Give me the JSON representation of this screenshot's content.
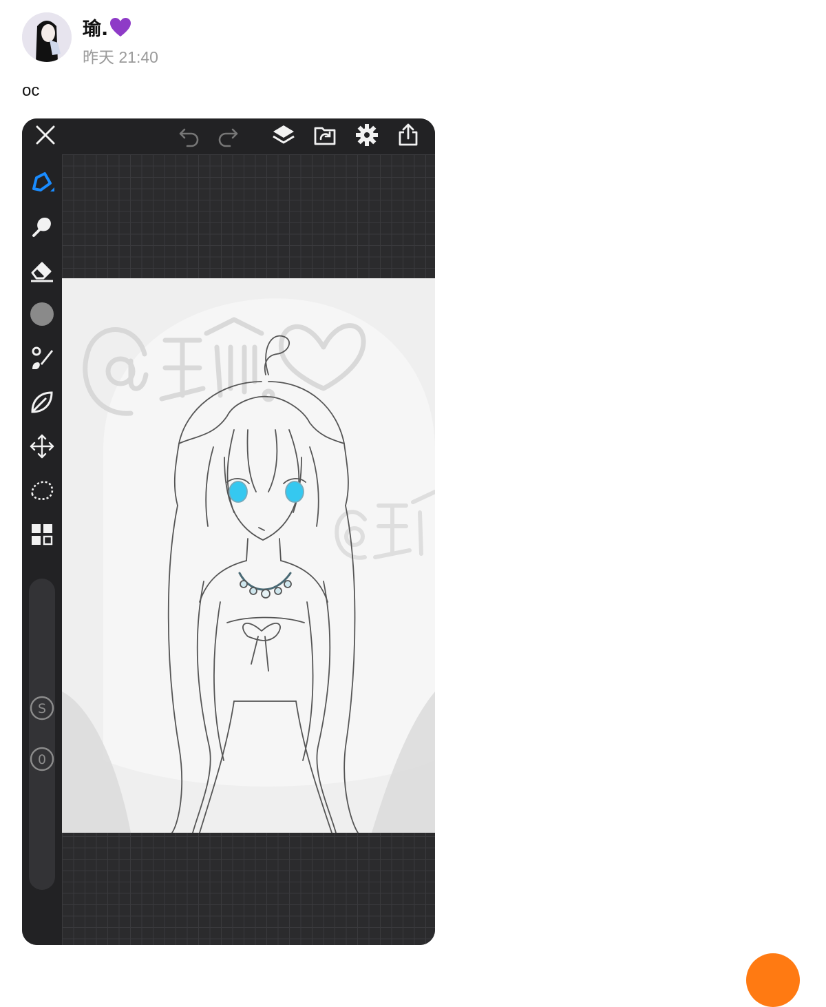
{
  "post": {
    "author": "瑜.",
    "author_emoji": "purple-heart",
    "timestamp": "昨天 21:40",
    "text": "oc"
  },
  "app": {
    "topbar_icons": [
      "close-icon",
      "undo-icon",
      "redo-icon",
      "layers-icon",
      "import-icon",
      "settings-icon",
      "share-icon"
    ],
    "tools": [
      "pen-icon",
      "smudge-icon",
      "eraser-icon",
      "color-swatch",
      "brush-icon",
      "leaf-brush-icon",
      "move-icon",
      "lasso-icon",
      "filter-grid-icon"
    ],
    "size_slider_label": "S",
    "opacity_slider_label": "0",
    "active_tool_color": "#1a8cff",
    "current_color": "#8a8a8a"
  },
  "artwork": {
    "description_watermark": "@瑜.♡",
    "watermark_secondary": "@瑜",
    "eye_color": "#35c8f0"
  },
  "colors": {
    "accent_orange": "#ff7a12",
    "heart_purple": "#8e3bc7"
  }
}
